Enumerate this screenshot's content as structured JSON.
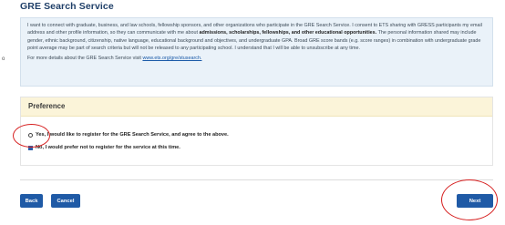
{
  "page": {
    "title": "GRE Search Service"
  },
  "consent": {
    "text_part1": "I want to connect with graduate, business, and law schools, fellowship sponsors, and other organizations who participate in the GRE Search Service. I consent to ETS sharing with GRESS participants my email address and other profile information, so they can communicate with me about ",
    "bold1": "admissions, scholarships, fellowships, and other educational opportunities.",
    "text_part2": " The personal information shared may include gender, ethnic background, citizenship, native language, educational background and objectives, and undergraduate GPA. Broad GRE score bands (e.g. score ranges) in combination with undergraduate grade point average may be part of search criteria but will not be released to any participating school. I understand that I will be able to unsubscribe at any time.",
    "more_prefix": "For more details about the GRE Search Service visit ",
    "more_link": "www.ets.org/gre/stusearch."
  },
  "left_marker": "o",
  "preference": {
    "header": "Preference",
    "option_yes": "Yes, I would like to register for the GRE Search Service, and agree to the above.",
    "option_no": "No, I would prefer not to register for the service at this time."
  },
  "buttons": {
    "back": "Back",
    "cancel": "Cancel",
    "next": "Next"
  },
  "colors": {
    "primary_button": "#1f5aa6",
    "title": "#1f3f68",
    "info_background": "#eaf2f9",
    "preference_header_background": "#fbf4d9",
    "annotation": "#d61f1f"
  }
}
